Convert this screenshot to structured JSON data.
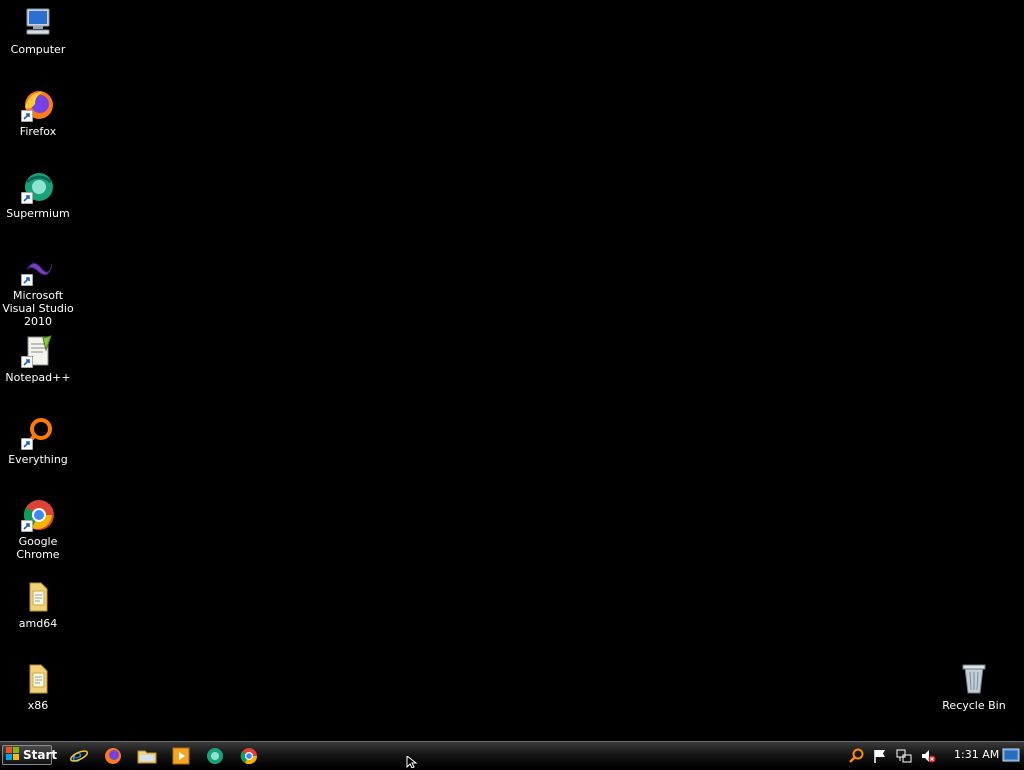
{
  "desktop": {
    "icons": [
      {
        "label": "Computer",
        "icon": "computer-icon"
      },
      {
        "label": "Firefox",
        "icon": "firefox-icon"
      },
      {
        "label": "Supermium",
        "icon": "supermium-icon"
      },
      {
        "label": "Microsoft Visual Studio 2010",
        "icon": "visual-studio-icon"
      },
      {
        "label": "Notepad++",
        "icon": "notepad-plus-plus-icon"
      },
      {
        "label": "Everything",
        "icon": "everything-icon"
      },
      {
        "label": "Google Chrome",
        "icon": "chrome-icon"
      },
      {
        "label": "amd64",
        "icon": "folder-icon"
      },
      {
        "label": "x86",
        "icon": "folder-icon"
      },
      {
        "label": "Recycle Bin",
        "icon": "recycle-bin-icon"
      }
    ]
  },
  "taskbar": {
    "start_label": "Start",
    "quick_launch": [
      "internet-explorer-icon",
      "firefox-icon",
      "file-explorer-icon",
      "media-player-icon",
      "supermium-icon",
      "chrome-icon"
    ],
    "tray": [
      "search-icon",
      "action-center-flag-icon",
      "network-icon",
      "volume-muted-icon"
    ],
    "clock": "1:31 AM"
  }
}
